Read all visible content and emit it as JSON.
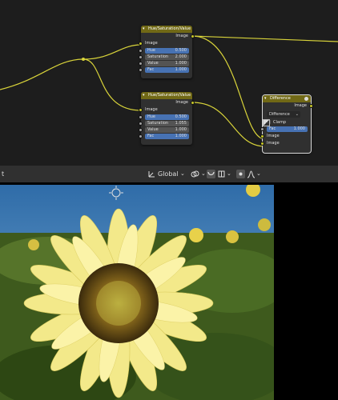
{
  "nodes": {
    "hsv1": {
      "title": "Hue/Saturation/Value",
      "output": "Image",
      "input_image": "Image",
      "fields": [
        {
          "label": "Hue",
          "value": "0.500"
        },
        {
          "label": "Saturation",
          "value": "2.000"
        },
        {
          "label": "Value",
          "value": "1.000"
        },
        {
          "label": "Fac",
          "value": "1.000"
        }
      ]
    },
    "hsv2": {
      "title": "Hue/Saturation/Value",
      "output": "Image",
      "input_image": "Image",
      "fields": [
        {
          "label": "Hue",
          "value": "0.500"
        },
        {
          "label": "Saturation",
          "value": "1.055"
        },
        {
          "label": "Value",
          "value": "1.000"
        },
        {
          "label": "Fac",
          "value": "1.000"
        }
      ]
    },
    "difference": {
      "title": "Difference",
      "output": "Image",
      "mode": "Difference",
      "clamp_label": "Clamp",
      "fac_label": "Fac",
      "fac_value": "1.000",
      "input_a": "Image",
      "input_b": "Image"
    }
  },
  "header": {
    "left_label": "t",
    "transform_orientation": "Global"
  },
  "colors": {
    "editor_bg": "#1d1d1d",
    "node_bg": "#303030",
    "node_header": "#716916",
    "wire": "#d9d43a",
    "socket_yellow": "#c7c729",
    "field_fill": "#4772b3"
  }
}
